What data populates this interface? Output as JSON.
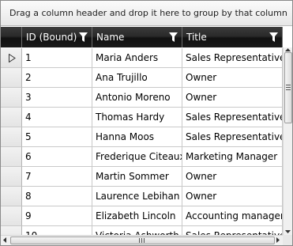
{
  "group_panel": {
    "hint": "Drag a column header and drop it here to group by that column"
  },
  "columns": [
    {
      "label": "ID (Bound)",
      "filter_icon": "filter-icon"
    },
    {
      "label": "Name",
      "filter_icon": "filter-icon"
    },
    {
      "label": "Title",
      "filter_icon": "filter-icon"
    }
  ],
  "rows": [
    {
      "id": "1",
      "name": "Maria Anders",
      "title": "Sales Representative",
      "current": true
    },
    {
      "id": "2",
      "name": "Ana Trujillo",
      "title": "Owner"
    },
    {
      "id": "3",
      "name": "Antonio Moreno",
      "title": "Owner"
    },
    {
      "id": "4",
      "name": "Thomas Hardy",
      "title": "Sales Representative"
    },
    {
      "id": "5",
      "name": "Hanna Moos",
      "title": "Sales Representative"
    },
    {
      "id": "6",
      "name": "Frederique Citeaux",
      "title": "Marketing Manager"
    },
    {
      "id": "7",
      "name": "Martin Sommer",
      "title": "Owner"
    },
    {
      "id": "8",
      "name": "Laurence Lebihan",
      "title": "Owner"
    },
    {
      "id": "9",
      "name": "Elizabeth Lincoln",
      "title": "Accounting manager"
    },
    {
      "id": "10",
      "name": "Victoria Ashworth",
      "title": "Sales Representative"
    }
  ],
  "icons": {
    "current_row": "current-row-indicator-icon",
    "scroll_up": "scroll-up-arrow-icon",
    "scroll_down": "scroll-down-arrow-icon",
    "scroll_left": "scroll-left-arrow-icon",
    "scroll_right": "scroll-right-arrow-icon"
  },
  "colors": {
    "header_bg": "#1a1a1a",
    "header_text": "#ffffff",
    "group_panel_bg": "#eeeeee",
    "grid_line": "#c9c9c9"
  }
}
